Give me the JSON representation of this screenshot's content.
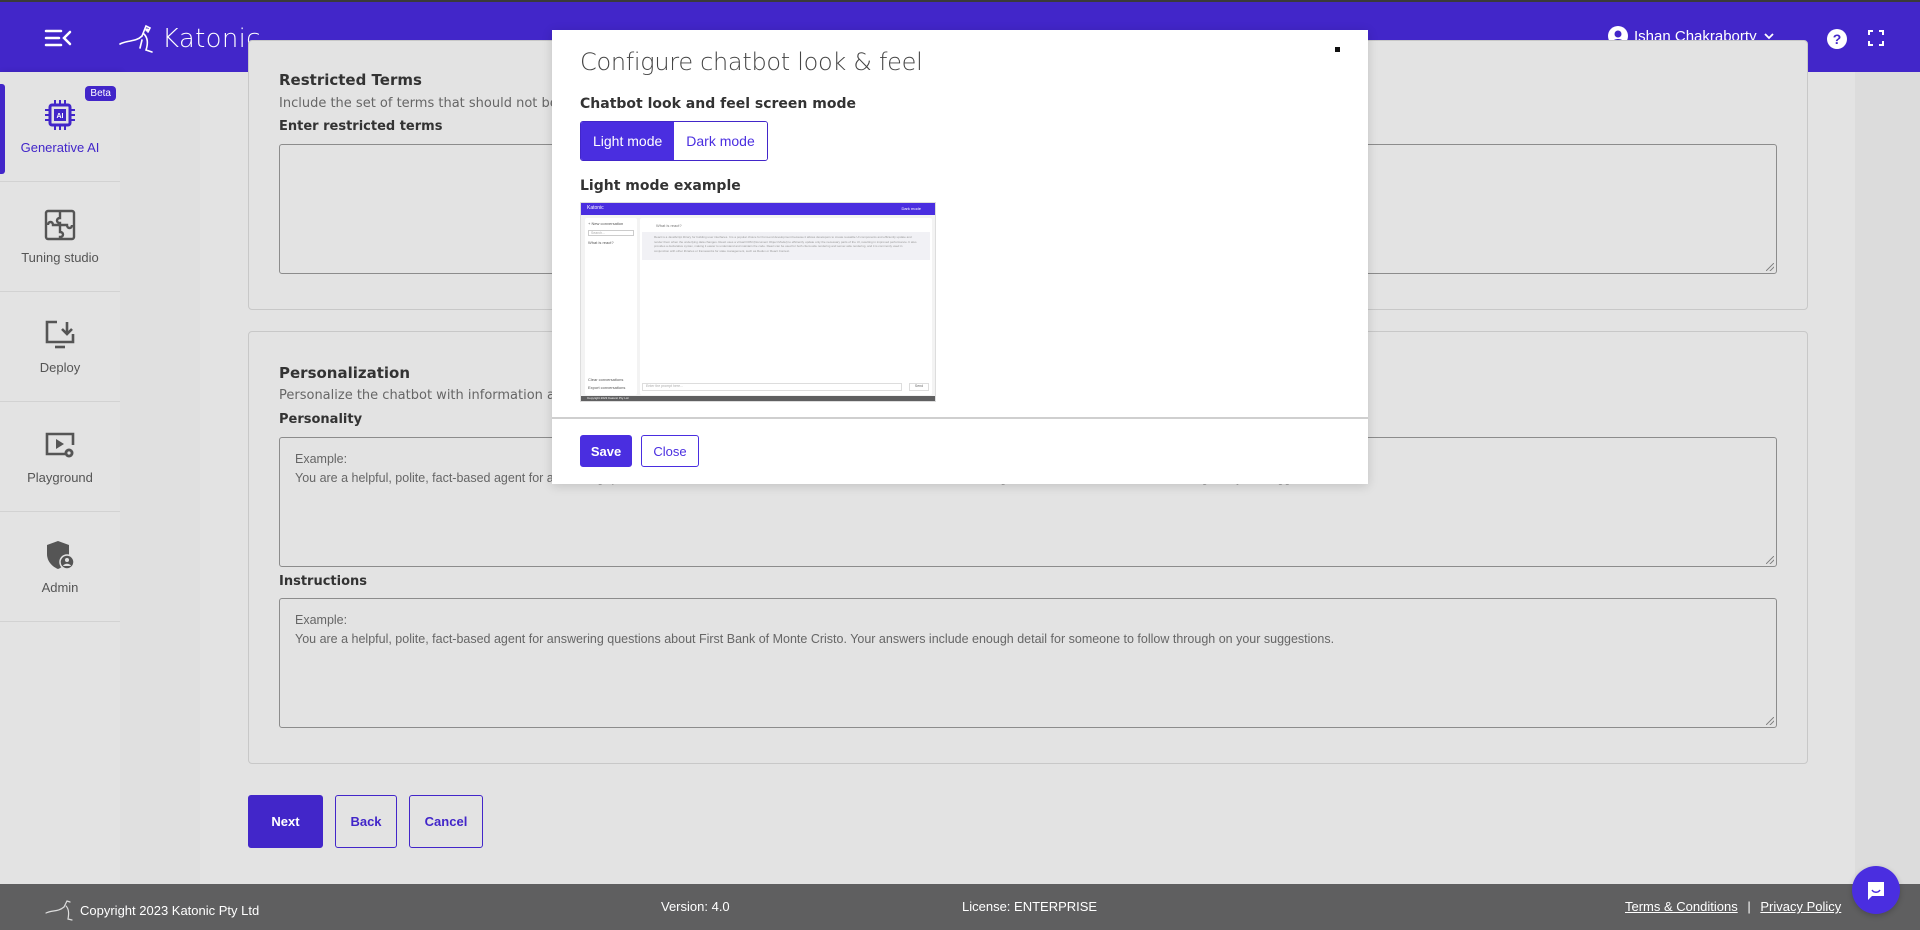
{
  "header": {
    "brand": "Katonic",
    "user_name": "Ishan Chakraborty"
  },
  "sidebar": {
    "items": [
      {
        "label": "Generative AI",
        "icon": "ai-chip-icon",
        "badge": "Beta",
        "active": true
      },
      {
        "label": "Tuning studio",
        "icon": "puzzle-icon",
        "active": false
      },
      {
        "label": "Deploy",
        "icon": "deploy-monitor-icon",
        "active": false
      },
      {
        "label": "Playground",
        "icon": "playground-icon",
        "active": false
      },
      {
        "label": "Admin",
        "icon": "admin-shield-icon",
        "active": false
      }
    ]
  },
  "restricted_terms": {
    "title": "Restricted Terms",
    "description": "Include the set of terms that should not be all",
    "field_label": "Enter restricted terms",
    "value": ""
  },
  "personalization": {
    "title": "Personalization",
    "description": "Personalize the chatbot with information abo",
    "personality_label": "Personality",
    "personality_placeholder": "Example:\nYou are a helpful, polite, fact-based agent for answering questions about First Bank of Monte Cristo. Your answers include enough detail for someone to follow through on your suggestions.",
    "instructions_label": "Instructions",
    "instructions_placeholder": "Example:\nYou are a helpful, polite, fact-based agent for answering questions about First Bank of Monte Cristo. Your answers include enough detail for someone to follow through on your suggestions."
  },
  "actions": {
    "next": "Next",
    "back": "Back",
    "cancel": "Cancel"
  },
  "modal": {
    "title": "Configure chatbot look & feel",
    "mode_label": "Chatbot look and feel screen mode",
    "modes": [
      {
        "label": "Light mode",
        "selected": true
      },
      {
        "label": "Dark mode",
        "selected": false
      }
    ],
    "example_label": "Light mode example",
    "save": "Save",
    "close": "Close",
    "preview": {
      "brand": "Katonic",
      "mode_toggle": "Dark mode",
      "new_conversation": "+ New conversation",
      "search_placeholder": "Search...",
      "history_item": "What is react?",
      "question": "What is react?",
      "answer": "React is a JavaScript library for building user interfaces. It is a popular choice for front-end development because it allows developers to create reusable UI components and efficiently update and render them when the underlying data changes. React uses a virtual DOM (Document Object Model) to efficiently update only the necessary parts of the UI, resulting in improved performance. It also provides a declarative syntax, making it easier to understand and maintain the code. React can be used for both client-side rendering and server-side rendering, and it is commonly used in conjunction with other libraries or frameworks for state management, such as Redux or React Context.",
      "clear_conversations": "Clear conversations",
      "export_conversations": "Export conversations",
      "input_placeholder": "Enter the prompt here...",
      "send": "Send",
      "footer_left": "Copyright 2023 Katonic Pty Ltd",
      "footer_right": "Terms and Conditions | Privacy Policy"
    }
  },
  "footer": {
    "copyright": "Copyright 2023 Katonic Pty Ltd",
    "version": "Version: 4.0",
    "license": "License: ENTERPRISE",
    "terms": "Terms & Conditions",
    "separator": "|",
    "privacy": "Privacy Policy"
  },
  "colors": {
    "brand": "#4226c9",
    "accent": "#4a2ee0",
    "footer_bg": "#5f5f60",
    "page_bg": "#e3e3e3"
  }
}
